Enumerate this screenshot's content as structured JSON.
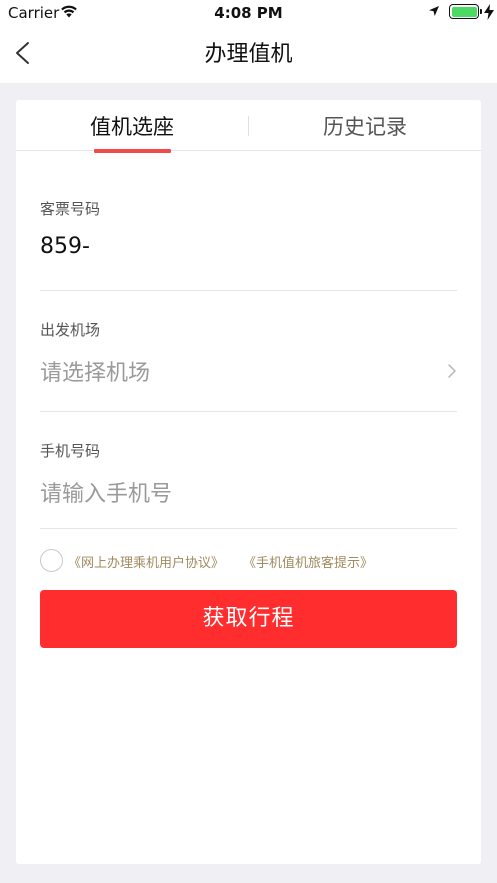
{
  "statusbar": {
    "carrier": "Carrier",
    "time": "4:08 PM",
    "battery_level_percent": 100,
    "icons": [
      "wifi-icon",
      "location-icon",
      "battery-icon",
      "charging-icon"
    ]
  },
  "nav": {
    "title": "办理值机",
    "back_icon": "chevron-left-icon"
  },
  "tabs": [
    {
      "label": "值机选座",
      "active": true
    },
    {
      "label": "历史记录",
      "active": false
    }
  ],
  "form": {
    "ticket": {
      "label": "客票号码",
      "value": "859-"
    },
    "airport": {
      "label": "出发机场",
      "placeholder": "请选择机场"
    },
    "phone": {
      "label": "手机号码",
      "placeholder": "请输入手机号"
    }
  },
  "agreement": {
    "checked": false,
    "link1": "《网上办理乘机用户协议》",
    "link2": "《手机值机旅客提示》"
  },
  "submit_label": "获取行程",
  "colors": {
    "accent": "#ff2d2d",
    "tab_indicator": "#f04a4a",
    "link": "#a08a5e",
    "background": "#efeff4",
    "battery": "#4cd964"
  }
}
